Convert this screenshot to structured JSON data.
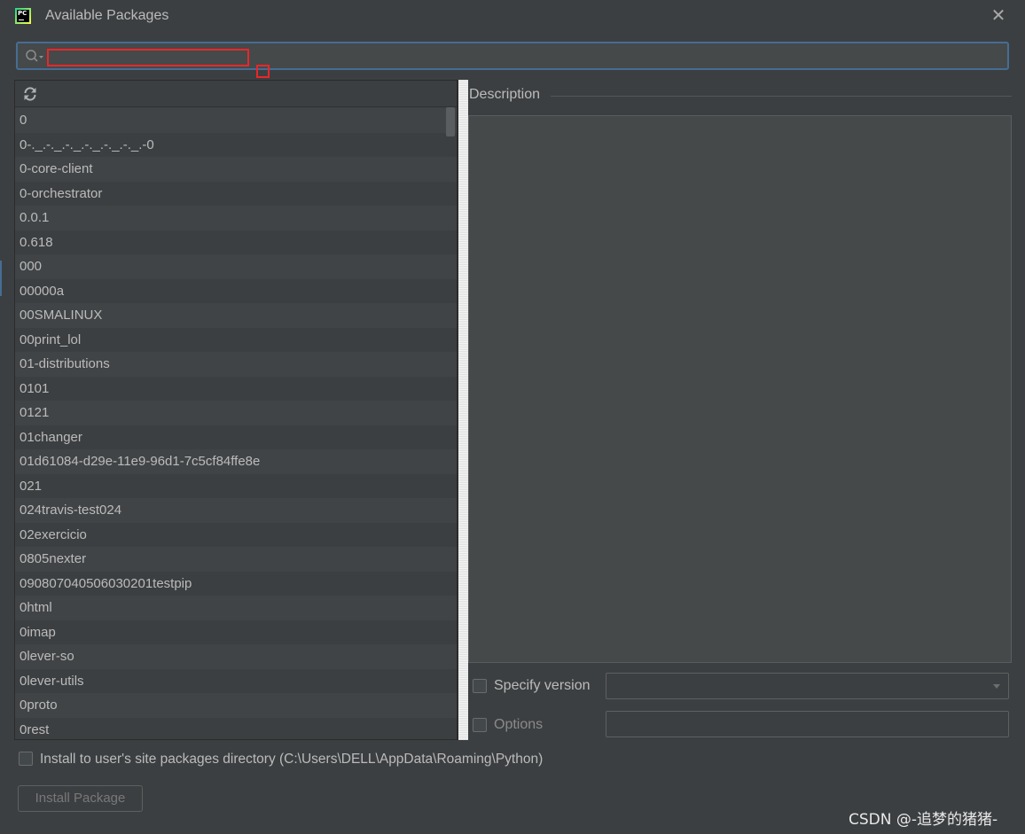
{
  "window": {
    "title": "Available Packages",
    "close_glyph": "✕"
  },
  "search": {
    "value": "",
    "placeholder": ""
  },
  "packages": [
    "0",
    "0-._.-._.-._.-._.-._.-._.-0",
    "0-core-client",
    "0-orchestrator",
    "0.0.1",
    "0.618",
    "000",
    "00000a",
    "00SMALINUX",
    "00print_lol",
    "01-distributions",
    "0101",
    "0121",
    "01changer",
    "01d61084-d29e-11e9-96d1-7c5cf84ffe8e",
    "021",
    "024travis-test024",
    "02exercicio",
    "0805nexter",
    "090807040506030201testpip",
    "0html",
    "0imap",
    "0lever-so",
    "0lever-utils",
    "0proto",
    "0rest"
  ],
  "description": {
    "label": "Description",
    "text": ""
  },
  "specify_version": {
    "label": "Specify version",
    "checked": false,
    "selected": ""
  },
  "options": {
    "label": "Options",
    "checked": false,
    "value": ""
  },
  "user_site": {
    "label": "Install to user's site packages directory (C:\\Users\\DELL\\AppData\\Roaming\\Python)",
    "checked": false
  },
  "install_button": {
    "label": "Install Package"
  },
  "watermark": "CSDN @-追梦的猪猪-",
  "colors": {
    "background": "#3c3f41",
    "focus_border": "#466d94",
    "highlight_annotation": "#e8272a",
    "text": "#bbbbbb"
  },
  "icons": {
    "app": "pycharm-logo",
    "search": "search-icon",
    "refresh": "refresh-icon",
    "close": "close-icon"
  }
}
